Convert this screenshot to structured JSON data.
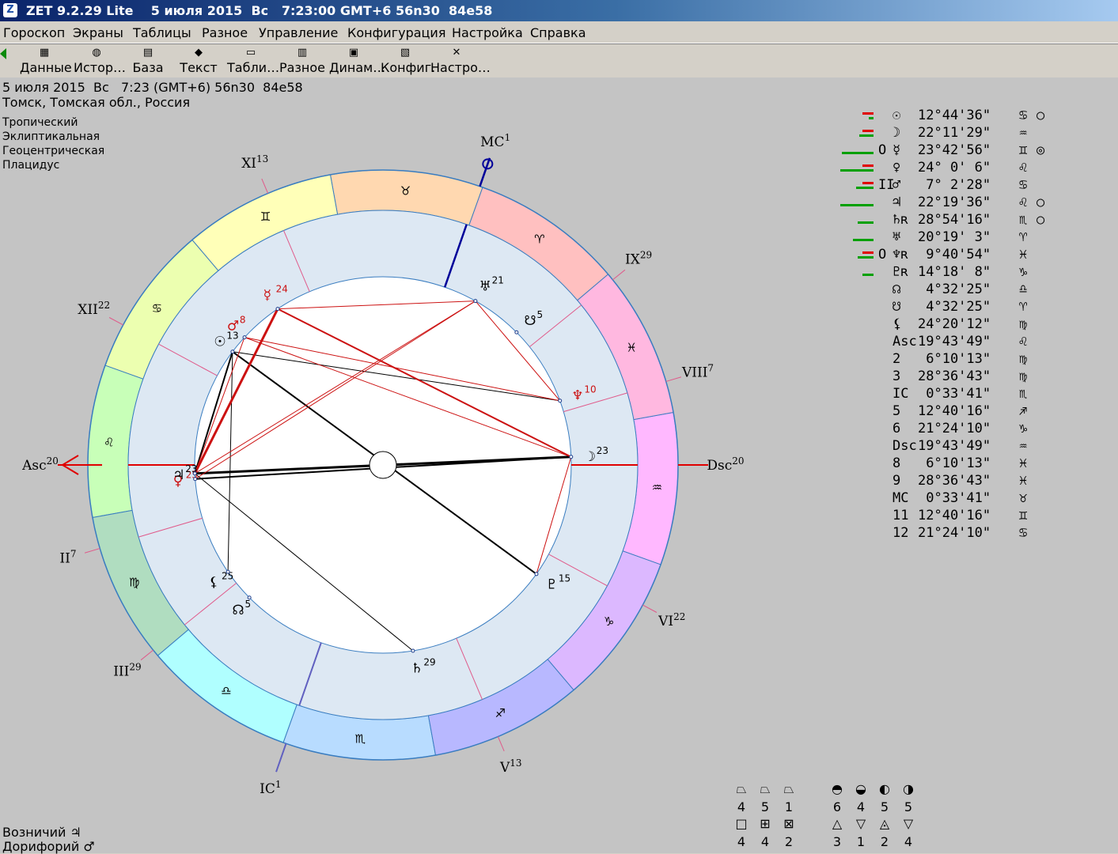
{
  "window": {
    "title": "ZET 9.2.29 Lite    5 июля 2015  Вс   7:23:00 GMT+6 56n30  84e58",
    "icon": "zet-app-icon"
  },
  "menu": [
    "Гороскоп",
    "Экраны",
    "Таблицы",
    "Разное",
    "Управление",
    "Конфигурация",
    "Настройка",
    "Справка"
  ],
  "toolbar": [
    {
      "label": "Данные",
      "icon": "table-icon"
    },
    {
      "label": "Истор…",
      "icon": "globe-icon"
    },
    {
      "label": "База",
      "icon": "database-icon"
    },
    {
      "label": "Текст",
      "icon": "book-icon"
    },
    {
      "label": "Табли…",
      "icon": "sheet-icon"
    },
    {
      "label": "Разное",
      "icon": "grid-icon"
    },
    {
      "label": "Динам…",
      "icon": "calendar-icon"
    },
    {
      "label": "Конфиг.",
      "icon": "config-icon"
    },
    {
      "label": "Настро…",
      "icon": "tools-icon"
    }
  ],
  "info": {
    "line1": "5 июля 2015  Вс   7:23 (GMT+6) 56n30  84e58",
    "line2": "Томск, Томская обл., Россия",
    "settings": [
      "Тропический",
      "Эклиптикальная",
      "Геоцентрическая",
      "Плацидус"
    ]
  },
  "colors": {
    "aspect_red": "#cc1111",
    "aspect_black": "#000000",
    "ring_blue": "#3a7dc0",
    "inner_ring": "#dde8f3"
  },
  "wheel": {
    "zodiac": [
      "♈",
      "♉",
      "♊",
      "♋",
      "♌",
      "♍",
      "♎",
      "♏",
      "♐",
      "♑",
      "♒",
      "♓"
    ],
    "zodiac_colors": [
      "#ffc0c0",
      "#ffd8b0",
      "#ffffb8",
      "#ecffb0",
      "#c8ffb8",
      "#b0ddc0",
      "#b0ffff",
      "#b8dcff",
      "#b8b8ff",
      "#dcb8ff",
      "#ffb8ff",
      "#ffb8e0"
    ],
    "asc_deg": 139.73,
    "houses": [
      {
        "label": "Asc",
        "num": "20",
        "deg": 139.73
      },
      {
        "label": "II",
        "num": "7",
        "deg": 156.17
      },
      {
        "label": "III",
        "num": "29",
        "deg": 178.61
      },
      {
        "label": "IC",
        "num": "1",
        "deg": 210.56
      },
      {
        "label": "V",
        "num": "13",
        "deg": 252.67
      },
      {
        "label": "VI",
        "num": "22",
        "deg": 291.4
      },
      {
        "label": "Dsc",
        "num": "20",
        "deg": 319.73
      },
      {
        "label": "VIII",
        "num": "7",
        "deg": 336.17
      },
      {
        "label": "IX",
        "num": "29",
        "deg": 358.61
      },
      {
        "label": "MC",
        "num": "1",
        "deg": 30.56
      },
      {
        "label": "XI",
        "num": "13",
        "deg": 72.67
      },
      {
        "label": "XII",
        "num": "22",
        "deg": 111.4
      }
    ],
    "planets": [
      {
        "sym": "☉",
        "deg": "13",
        "lon": 102.74,
        "color": "#000000",
        "retro": false
      },
      {
        "sym": "☽",
        "deg": "23",
        "lon": 322.19,
        "color": "#000000",
        "retro": false
      },
      {
        "sym": "☿",
        "deg": "24",
        "lon": 83.72,
        "color": "#cc1111",
        "retro": false
      },
      {
        "sym": "♀",
        "deg": "25",
        "lon": 144.0,
        "color": "#cc1111",
        "retro": false
      },
      {
        "sym": "♂",
        "deg": "8",
        "lon": 97.04,
        "color": "#cc1111",
        "retro": false
      },
      {
        "sym": "♃",
        "deg": "23",
        "lon": 142.33,
        "color": "#000000",
        "retro": false
      },
      {
        "sym": "♄",
        "deg": "29",
        "lon": 238.9,
        "color": "#000000",
        "retro": true
      },
      {
        "sym": "♅",
        "deg": "21",
        "lon": 20.32,
        "color": "#000000",
        "retro": false
      },
      {
        "sym": "♆",
        "deg": "10",
        "lon": 339.68,
        "color": "#cc1111",
        "retro": true
      },
      {
        "sym": "♇",
        "deg": "15",
        "lon": 284.31,
        "color": "#000000",
        "retro": true
      },
      {
        "sym": "☊",
        "deg": "5",
        "lon": 184.54,
        "color": "#000000",
        "retro": false
      },
      {
        "sym": "☋",
        "deg": "5",
        "lon": 4.54,
        "color": "#000000",
        "retro": false
      },
      {
        "sym": "⚸",
        "deg": "25",
        "lon": 174.34,
        "color": "#000000",
        "retro": false
      }
    ],
    "aspects": [
      {
        "a": 102.74,
        "b": 142.33,
        "color": "#000000",
        "w": 2
      },
      {
        "a": 102.74,
        "b": 284.31,
        "color": "#000000",
        "w": 2
      },
      {
        "a": 142.33,
        "b": 322.19,
        "color": "#000000",
        "w": 3
      },
      {
        "a": 144.0,
        "b": 322.19,
        "color": "#000000",
        "w": 2
      },
      {
        "a": 142.33,
        "b": 238.9,
        "color": "#000000",
        "w": 1
      },
      {
        "a": 102.74,
        "b": 339.68,
        "color": "#000000",
        "w": 1
      },
      {
        "a": 102.74,
        "b": 174.34,
        "color": "#000000",
        "w": 1
      },
      {
        "a": 83.72,
        "b": 322.19,
        "color": "#cc1111",
        "w": 2
      },
      {
        "a": 83.72,
        "b": 20.32,
        "color": "#cc1111",
        "w": 1
      },
      {
        "a": 83.72,
        "b": 142.33,
        "color": "#cc1111",
        "w": 3
      },
      {
        "a": 97.04,
        "b": 142.33,
        "color": "#cc1111",
        "w": 1
      },
      {
        "a": 97.04,
        "b": 339.68,
        "color": "#cc1111",
        "w": 1
      },
      {
        "a": 97.04,
        "b": 322.19,
        "color": "#cc1111",
        "w": 1
      },
      {
        "a": 142.33,
        "b": 20.32,
        "color": "#cc1111",
        "w": 1
      },
      {
        "a": 144.0,
        "b": 20.32,
        "color": "#cc1111",
        "w": 1
      },
      {
        "a": 20.32,
        "b": 339.68,
        "color": "#cc1111",
        "w": 1
      },
      {
        "a": 322.19,
        "b": 284.31,
        "color": "#cc1111",
        "w": 1
      }
    ]
  },
  "planet_table": [
    {
      "sym": "☉",
      "pos": "12°44'36\"",
      "sign": "♋",
      "extra": "○",
      "red": 14,
      "green": 6
    },
    {
      "sym": "☽",
      "pos": "22°11'29\"",
      "sign": "♒",
      "extra": "",
      "red": 14,
      "green": 18
    },
    {
      "sym": "☿",
      "pre": "O",
      "pos": "23°42'56\"",
      "sign": "♊",
      "extra": "◎",
      "red": 0,
      "green": 40
    },
    {
      "sym": "♀",
      "pos": "24° 0' 6\"",
      "sign": "♌",
      "extra": "",
      "red": 14,
      "green": 42
    },
    {
      "sym": "♂",
      "pre": "II",
      "pos": " 7° 2'28\"",
      "sign": "♋",
      "extra": "",
      "red": 14,
      "green": 22
    },
    {
      "sym": "♃",
      "pos": "22°19'36\"",
      "sign": "♌",
      "extra": "○",
      "red": 0,
      "green": 42
    },
    {
      "sym": "♄ʀ",
      "pos": "28°54'16\"",
      "sign": "♏",
      "extra": "○",
      "red": 0,
      "green": 20
    },
    {
      "sym": "♅",
      "pos": "20°19' 3\"",
      "sign": "♈",
      "extra": "",
      "red": 0,
      "green": 26
    },
    {
      "sym": "♆ʀ",
      "pre": "O",
      "pos": " 9°40'54\"",
      "sign": "♓",
      "extra": "",
      "red": 14,
      "green": 20
    },
    {
      "sym": "♇ʀ",
      "pos": "14°18' 8\"",
      "sign": "♑",
      "extra": "",
      "red": 0,
      "green": 14
    },
    {
      "sym": "☊",
      "pos": " 4°32'25\"",
      "sign": "♎",
      "extra": "",
      "red": 0,
      "green": 0
    },
    {
      "sym": "☋",
      "pos": " 4°32'25\"",
      "sign": "♈",
      "extra": "",
      "red": 0,
      "green": 0
    },
    {
      "sym": "⚸",
      "pos": "24°20'12\"",
      "sign": "♍",
      "extra": "",
      "red": 0,
      "green": 0
    },
    {
      "sym": "Asc",
      "pos": "19°43'49\"",
      "sign": "♌",
      "extra": "",
      "red": 0,
      "green": 0
    },
    {
      "sym": "2",
      "pos": " 6°10'13\"",
      "sign": "♍",
      "extra": "",
      "red": 0,
      "green": 0
    },
    {
      "sym": "3",
      "pos": "28°36'43\"",
      "sign": "♍",
      "extra": "",
      "red": 0,
      "green": 0
    },
    {
      "sym": "IC",
      "pos": " 0°33'41\"",
      "sign": "♏",
      "extra": "",
      "red": 0,
      "green": 0
    },
    {
      "sym": "5",
      "pos": "12°40'16\"",
      "sign": "♐",
      "extra": "",
      "red": 0,
      "green": 0
    },
    {
      "sym": "6",
      "pos": "21°24'10\"",
      "sign": "♑",
      "extra": "",
      "red": 0,
      "green": 0
    },
    {
      "sym": "Dsc",
      "pos": "19°43'49\"",
      "sign": "♒",
      "extra": "",
      "red": 0,
      "green": 0
    },
    {
      "sym": "8",
      "pos": " 6°10'13\"",
      "sign": "♓",
      "extra": "",
      "red": 0,
      "green": 0
    },
    {
      "sym": "9",
      "pos": "28°36'43\"",
      "sign": "♓",
      "extra": "",
      "red": 0,
      "green": 0
    },
    {
      "sym": "MC",
      "pos": " 0°33'41\"",
      "sign": "♉",
      "extra": "",
      "red": 0,
      "green": 0
    },
    {
      "sym": "11",
      "pos": "12°40'16\"",
      "sign": "♊",
      "extra": "",
      "red": 0,
      "green": 0
    },
    {
      "sym": "12",
      "pos": "21°24'10\"",
      "sign": "♋",
      "extra": "",
      "red": 0,
      "green": 0
    }
  ],
  "elements": {
    "row1_syms": [
      "⏢",
      "⏢",
      "⏢"
    ],
    "row1_vals": [
      "4",
      "5",
      "1"
    ],
    "row2_syms": [
      "□",
      "⊞",
      "⊠"
    ],
    "row2_vals": [
      "4",
      "4",
      "2"
    ],
    "row1b_syms": [
      "◓",
      "◒",
      "◐",
      "◑"
    ],
    "row1b_vals": [
      "6",
      "4",
      "5",
      "5"
    ],
    "row2b_syms": [
      "△",
      "▽",
      "◬",
      "▽"
    ],
    "row2b_vals": [
      "3",
      "1",
      "2",
      "4"
    ]
  },
  "bottom": {
    "ruler": "Возничий ♃",
    "doryphory": "Дорифорий ♂"
  }
}
